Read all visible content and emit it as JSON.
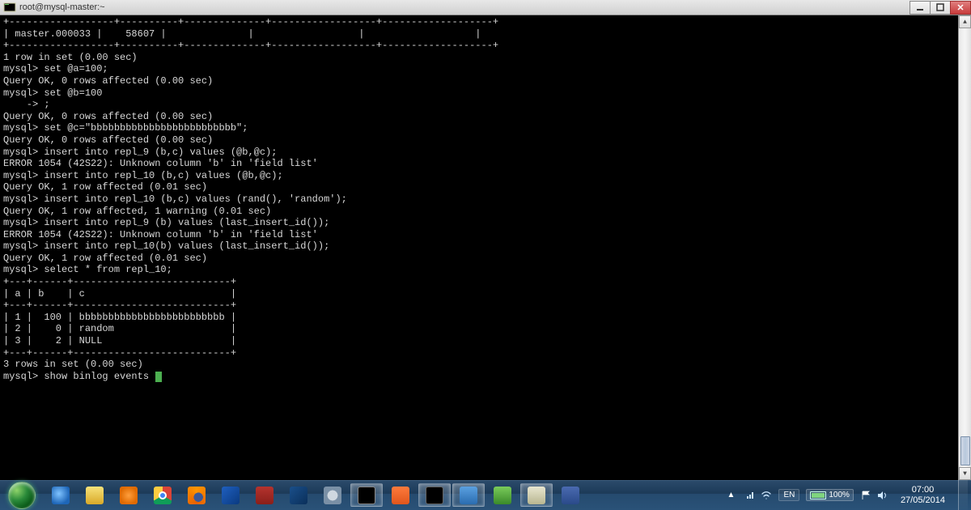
{
  "window": {
    "title": "root@mysql-master:~"
  },
  "terminal": {
    "lines": [
      "+------------------+----------+--------------+------------------+-------------------+",
      "| master.000033 |    58607 |              |                  |                   |",
      "+------------------+----------+--------------+------------------+-------------------+",
      "1 row in set (0.00 sec)",
      "",
      "mysql> set @a=100;",
      "Query OK, 0 rows affected (0.00 sec)",
      "",
      "mysql> set @b=100",
      "    -> ;",
      "Query OK, 0 rows affected (0.00 sec)",
      "",
      "mysql> set @c=\"bbbbbbbbbbbbbbbbbbbbbbbbb\";",
      "Query OK, 0 rows affected (0.00 sec)",
      "",
      "mysql> insert into repl_9 (b,c) values (@b,@c);",
      "ERROR 1054 (42S22): Unknown column 'b' in 'field list'",
      "mysql> insert into repl_10 (b,c) values (@b,@c);",
      "Query OK, 1 row affected (0.01 sec)",
      "",
      "mysql> insert into repl_10 (b,c) values (rand(), 'random');",
      "Query OK, 1 row affected, 1 warning (0.01 sec)",
      "",
      "mysql> insert into repl_9 (b) values (last_insert_id());",
      "ERROR 1054 (42S22): Unknown column 'b' in 'field list'",
      "mysql> insert into repl_10(b) values (last_insert_id());",
      "Query OK, 1 row affected (0.01 sec)",
      "",
      "mysql> select * from repl_10;",
      "+---+------+---------------------------+",
      "| a | b    | c                         |",
      "+---+------+---------------------------+",
      "| 1 |  100 | bbbbbbbbbbbbbbbbbbbbbbbbb |",
      "| 2 |    0 | random                    |",
      "| 3 |    2 | NULL                      |",
      "+---+------+---------------------------+",
      "3 rows in set (0.00 sec)",
      "",
      "mysql> show binlog events "
    ]
  },
  "taskbar": {
    "items": [
      {
        "name": "internet-explorer",
        "cls": "ic-ie"
      },
      {
        "name": "file-explorer",
        "cls": "ic-explorer"
      },
      {
        "name": "windows-media-player",
        "cls": "ic-wmp"
      },
      {
        "name": "chrome",
        "cls": "ic-chrome"
      },
      {
        "name": "firefox",
        "cls": "ic-firefox"
      },
      {
        "name": "thunderbird",
        "cls": "ic-tbird"
      },
      {
        "name": "adobe-reader",
        "cls": "ic-pdf"
      },
      {
        "name": "virtualbox",
        "cls": "ic-vbox"
      },
      {
        "name": "vault",
        "cls": "ic-vault"
      },
      {
        "name": "terminal-1",
        "cls": "ic-term",
        "active": true
      },
      {
        "name": "util-orange",
        "cls": "ic-orange"
      },
      {
        "name": "cmd",
        "cls": "ic-cmd",
        "active": true
      },
      {
        "name": "app-blue",
        "cls": "ic-blue1",
        "active": true
      },
      {
        "name": "app-green",
        "cls": "ic-green"
      },
      {
        "name": "putty",
        "cls": "ic-putty",
        "active": true
      },
      {
        "name": "save-app",
        "cls": "ic-save"
      }
    ]
  },
  "tray": {
    "lang": "EN",
    "battery_pct": "100%",
    "time": "07:00",
    "date": "27/05/2014"
  }
}
